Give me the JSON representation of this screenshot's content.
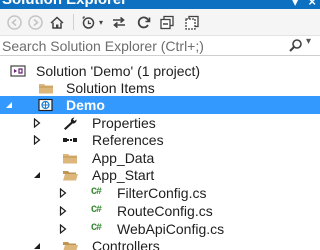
{
  "window": {
    "title": "Solution Explorer"
  },
  "toolbar": {
    "buttons": [
      "back-icon",
      "forward-icon",
      "home-icon",
      "history-icon",
      "sync-icon",
      "refresh-icon",
      "collapse-all-icon",
      "show-all-files-icon"
    ]
  },
  "search": {
    "placeholder": "Search Solution Explorer (Ctrl+;)"
  },
  "tree": {
    "solution": "Solution 'Demo' (1 project)",
    "solution_items": "Solution Items",
    "project": "Demo",
    "properties": "Properties",
    "references": "References",
    "app_data": "App_Data",
    "app_start": "App_Start",
    "filter_config": "FilterConfig.cs",
    "route_config": "RouteConfig.cs",
    "webapi_config": "WebApiConfig.cs",
    "controllers": "Controllers"
  },
  "colors": {
    "title_bar": "#0e70c0",
    "selection": "#3399ff",
    "folder": "#dcb67a",
    "csharp": "#388a34"
  }
}
